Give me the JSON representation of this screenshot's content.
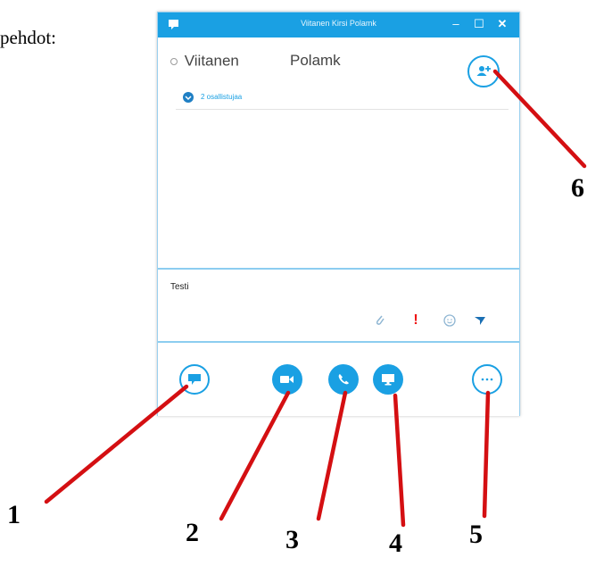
{
  "document": {
    "caption_fragment": "pehdot:"
  },
  "window": {
    "title": "Viitanen Kirsi Polamk",
    "controls": {
      "minimize": "–",
      "maximize": "☐",
      "close": "✕"
    }
  },
  "contact": {
    "first_name": "Viitanen",
    "last_name": "Polamk",
    "participants_label": "2 osallistujaa"
  },
  "compose": {
    "text": "Testi"
  },
  "icons": {
    "logo": "skype-logo-icon",
    "add_people": "add-people-icon",
    "participants": "participants-icon",
    "attach": "paperclip-icon",
    "important": "exclamation-icon",
    "emoticon": "smiley-icon",
    "send": "send-arrow-icon",
    "im": "chat-bubble-icon",
    "video": "video-camera-icon",
    "call": "phone-icon",
    "share": "monitor-icon",
    "more": "more-options-icon"
  },
  "annotations": [
    "1",
    "2",
    "3",
    "4",
    "5",
    "6"
  ],
  "colors": {
    "accent": "#1aa0e3",
    "arrow": "#d40f12",
    "important": "#ee1111"
  }
}
